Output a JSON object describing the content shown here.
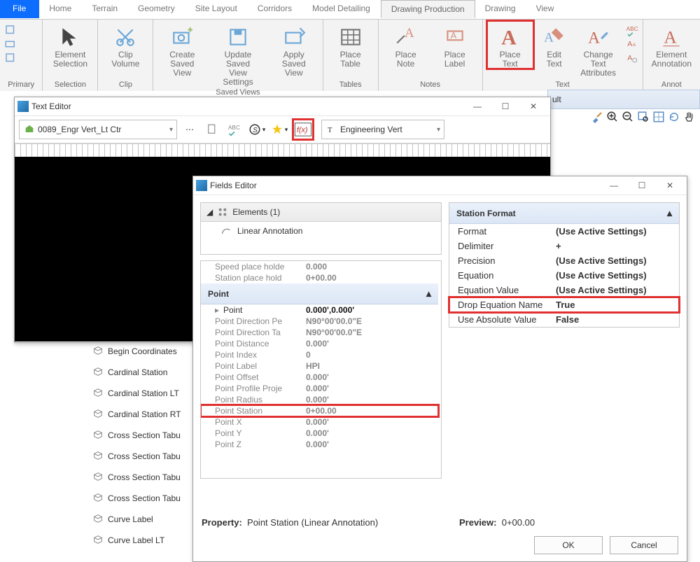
{
  "ribbon": {
    "tabs": [
      "File",
      "Home",
      "Terrain",
      "Geometry",
      "Site Layout",
      "Corridors",
      "Model Detailing",
      "Drawing Production",
      "Drawing",
      "View"
    ],
    "activeIndex": 7,
    "groups": {
      "primary": "Primary",
      "selection": "Selection",
      "clip": "Clip",
      "savedViews": "Saved Views",
      "tables": "Tables",
      "notes": "Notes",
      "text": "Text",
      "annot": "Annot"
    },
    "btns": {
      "elementSelection": "Element\nSelection",
      "clipVolume": "Clip\nVolume",
      "createSavedView": "Create\nSaved View",
      "updateSavedViewSettings": "Update Saved\nView Settings",
      "applySavedView": "Apply\nSaved View",
      "placeTable": "Place\nTable",
      "placeNote": "Place\nNote",
      "placeLabel": "Place\nLabel",
      "placeText": "Place\nText",
      "editText": "Edit\nText",
      "changeTextAttributes": "Change Text\nAttributes",
      "elementAnnotation": "Element\nAnnotation"
    }
  },
  "trStrip": "ult",
  "textEditor": {
    "title": "Text Editor",
    "style": "0089_Engr Vert_Lt Ctr",
    "font": "Engineering Vert"
  },
  "tree": [
    "Begin Coordinates",
    "Cardinal Station",
    "Cardinal Station LT",
    "Cardinal Station RT",
    "Cross Section Tabu",
    "Cross Section Tabu",
    "Cross Section Tabu",
    "Cross Section Tabu",
    "Curve Label",
    "Curve Label LT"
  ],
  "fieldsEditor": {
    "title": "Fields Editor",
    "elementsHeader": "Elements (1)",
    "elementsItem": "Linear Annotation",
    "preRows": [
      {
        "k": "Speed place holde",
        "v": "0.000"
      },
      {
        "k": "Station place hold",
        "v": "0+00.00"
      }
    ],
    "pointHeader": "Point",
    "pointRows": [
      {
        "k": "Point",
        "v": "0.000',0.000'",
        "bold": true
      },
      {
        "k": "Point Direction Pe",
        "v": "N90°00'00.0\"E"
      },
      {
        "k": "Point Direction Ta",
        "v": "N90°00'00.0\"E"
      },
      {
        "k": "Point Distance",
        "v": "0.000'"
      },
      {
        "k": "Point Index",
        "v": "0"
      },
      {
        "k": "Point Label",
        "v": "HPI"
      },
      {
        "k": "Point Offset",
        "v": "0.000'"
      },
      {
        "k": "Point Profile Proje",
        "v": "0.000'"
      },
      {
        "k": "Point Radius",
        "v": "0.000'"
      },
      {
        "k": "Point Station",
        "v": "0+00.00",
        "hl": true
      },
      {
        "k": "Point X",
        "v": "0.000'"
      },
      {
        "k": "Point Y",
        "v": "0.000'"
      },
      {
        "k": "Point Z",
        "v": "0.000'"
      }
    ],
    "propertyLabel": "Property:",
    "propertyValue": "Point Station (Linear Annotation)",
    "previewLabel": "Preview:",
    "previewValue": "0+00.00",
    "stationFormat": {
      "header": "Station Format",
      "rows": [
        {
          "k": "Format",
          "v": "(Use Active Settings)"
        },
        {
          "k": "Delimiter",
          "v": "+"
        },
        {
          "k": "Precision",
          "v": "(Use Active Settings)"
        },
        {
          "k": "Equation",
          "v": "(Use Active Settings)"
        },
        {
          "k": "Equation Value",
          "v": "(Use Active Settings)"
        },
        {
          "k": "Drop Equation Name",
          "v": "True",
          "hl": true
        },
        {
          "k": "Use Absolute Value",
          "v": "False"
        }
      ]
    },
    "ok": "OK",
    "cancel": "Cancel"
  }
}
